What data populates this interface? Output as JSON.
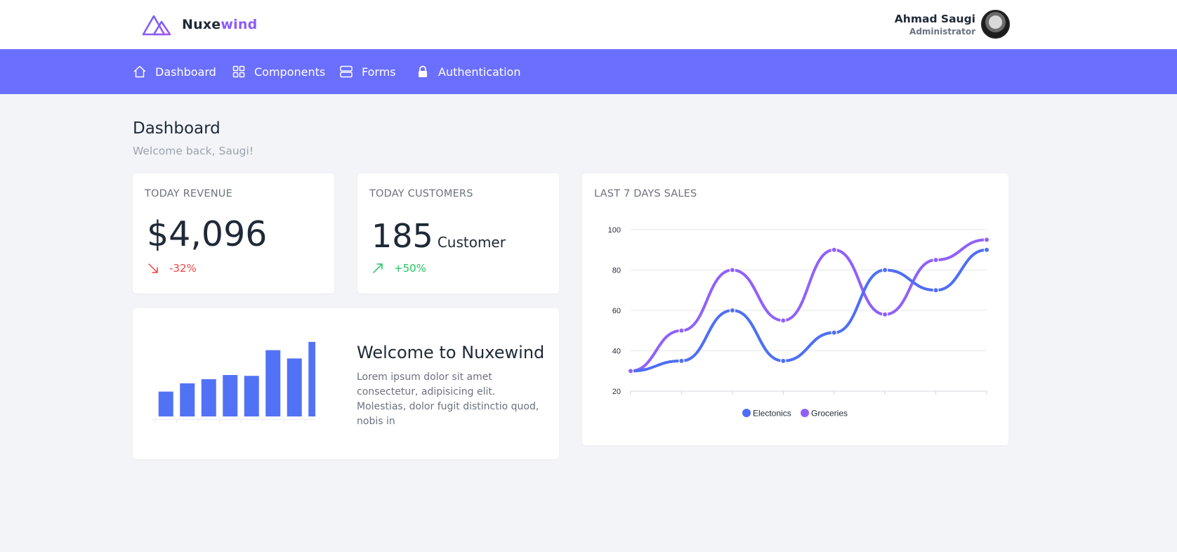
{
  "brand": {
    "part1": "Nuxe",
    "part2": "wind",
    "accent": "#8b5cf6"
  },
  "user": {
    "name": "Ahmad Saugi",
    "role": "Administrator"
  },
  "nav": {
    "color": "#6b6ffd",
    "items": [
      {
        "label": "Dashboard",
        "icon": "home-icon"
      },
      {
        "label": "Components",
        "icon": "grid-icon"
      },
      {
        "label": "Forms",
        "icon": "forms-icon"
      },
      {
        "label": "Authentication",
        "icon": "lock-icon"
      }
    ]
  },
  "page": {
    "title": "Dashboard",
    "subtitle": "Welcome back, Saugi!"
  },
  "revenue": {
    "label": "TODAY REVENUE",
    "value": "$4,096",
    "delta": "-32%",
    "trend": "down",
    "color": "#ef4444"
  },
  "customers": {
    "label": "TODAY CUSTOMERS",
    "value": "185",
    "unit": "Customer",
    "delta": "+50%",
    "trend": "up",
    "color": "#22c55e"
  },
  "welcome": {
    "title": "Welcome to Nuxewind",
    "text": "Lorem ipsum dolor sit amet consectetur, adipisicing elit. Molestias, dolor fugit distinctio quod, nobis in"
  },
  "sales": {
    "label": "LAST 7 DAYS SALES"
  },
  "chart_data": [
    {
      "type": "bar",
      "categories": [
        "",
        "",
        "",
        "",
        "",
        "",
        "",
        ""
      ],
      "values": [
        30,
        40,
        45,
        50,
        49,
        80,
        70,
        90
      ],
      "ylim": [
        0,
        100
      ],
      "colors": {
        "bar": "#5272f5"
      }
    },
    {
      "type": "line",
      "title": "",
      "x": [
        1,
        2,
        3,
        4,
        5,
        6,
        7,
        8
      ],
      "ylim": [
        20,
        100
      ],
      "yticks": [
        20,
        40,
        60,
        80,
        100
      ],
      "grid": true,
      "legend": "bottom",
      "series": [
        {
          "name": "Electonics",
          "values": [
            30,
            35,
            60,
            35,
            49,
            80,
            70,
            90
          ],
          "color": "#4f6ef5"
        },
        {
          "name": "Groceries",
          "values": [
            30,
            50,
            80,
            55,
            90,
            58,
            85,
            95
          ],
          "color": "#9061f9"
        }
      ]
    }
  ]
}
